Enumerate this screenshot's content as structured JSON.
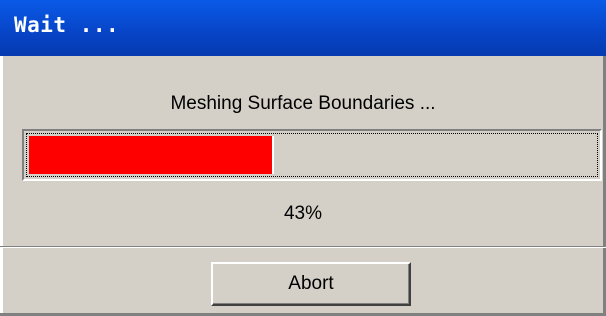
{
  "window": {
    "title": "Wait ..."
  },
  "dialog": {
    "message": "Meshing Surface Boundaries ...",
    "progress_fraction": 0.43,
    "progress_text": "43%",
    "abort_label": "Abort"
  },
  "colors": {
    "titlebar": "#0744c6",
    "progress_fill": "#fe0000",
    "dialog_bg": "#d4d0c8"
  }
}
